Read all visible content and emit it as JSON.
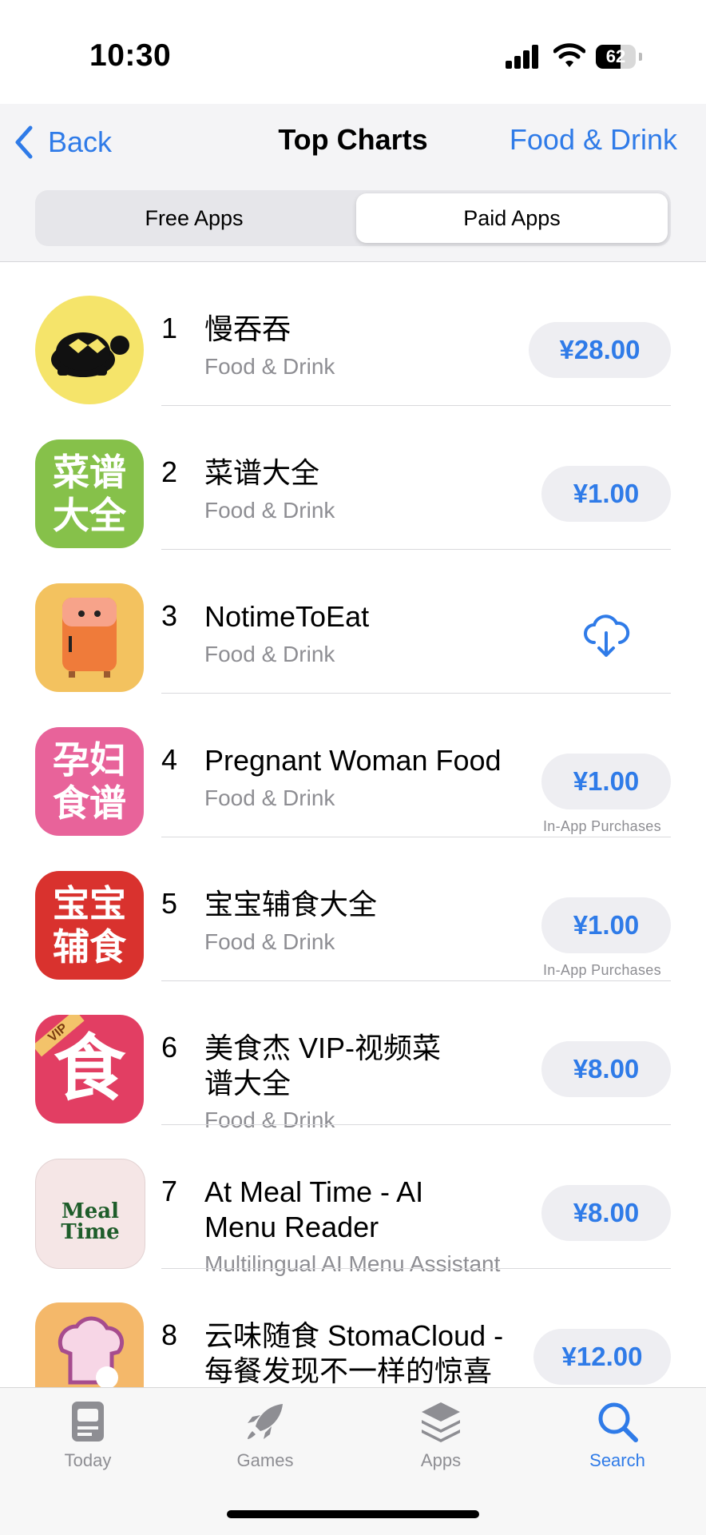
{
  "status_bar": {
    "time": "10:30",
    "battery": "62"
  },
  "nav": {
    "back_label": "Back",
    "title": "Top Charts",
    "category": "Food & Drink"
  },
  "segments": {
    "free": "Free Apps",
    "paid": "Paid Apps"
  },
  "apps": [
    {
      "rank": "1",
      "name": "慢吞吞",
      "subtitle": "Food & Drink",
      "price": "¥28.00",
      "icon_text": ""
    },
    {
      "rank": "2",
      "name": "菜谱大全",
      "subtitle": "Food & Drink",
      "price": "¥1.00",
      "icon_text": "菜谱大全"
    },
    {
      "rank": "3",
      "name": "NotimeToEat",
      "subtitle": "Food & Drink",
      "action": "cloud-download"
    },
    {
      "rank": "4",
      "name": "Pregnant Woman Food",
      "subtitle": "Food & Drink",
      "price": "¥1.00",
      "note": "In-App Purchases",
      "icon_text": "孕妇食谱"
    },
    {
      "rank": "5",
      "name": "宝宝辅食大全",
      "subtitle": "Food & Drink",
      "price": "¥1.00",
      "note": "In-App Purchases",
      "icon_text": "宝宝辅食"
    },
    {
      "rank": "6",
      "name": "美食杰 VIP-视频菜谱大全",
      "subtitle": "Food & Drink",
      "price": "¥8.00",
      "icon_text": "食",
      "badge": "VIP"
    },
    {
      "rank": "7",
      "name": "At Meal Time - AI Menu Reader",
      "subtitle": "Multilingual AI Menu Assistant",
      "price": "¥8.00",
      "icon_text": "Meal Time"
    },
    {
      "rank": "8",
      "name": "云味随食 StomaCloud - 每餐发现不一样的惊喜",
      "price": "¥12.00"
    }
  ],
  "tabs": [
    {
      "label": "Today",
      "icon": "today-icon"
    },
    {
      "label": "Games",
      "icon": "rocket-icon"
    },
    {
      "label": "Apps",
      "icon": "apps-stack-icon"
    },
    {
      "label": "Search",
      "icon": "search-icon"
    }
  ],
  "colors": {
    "accent": "#2f7be8",
    "price_bg": "#eeeef2"
  }
}
